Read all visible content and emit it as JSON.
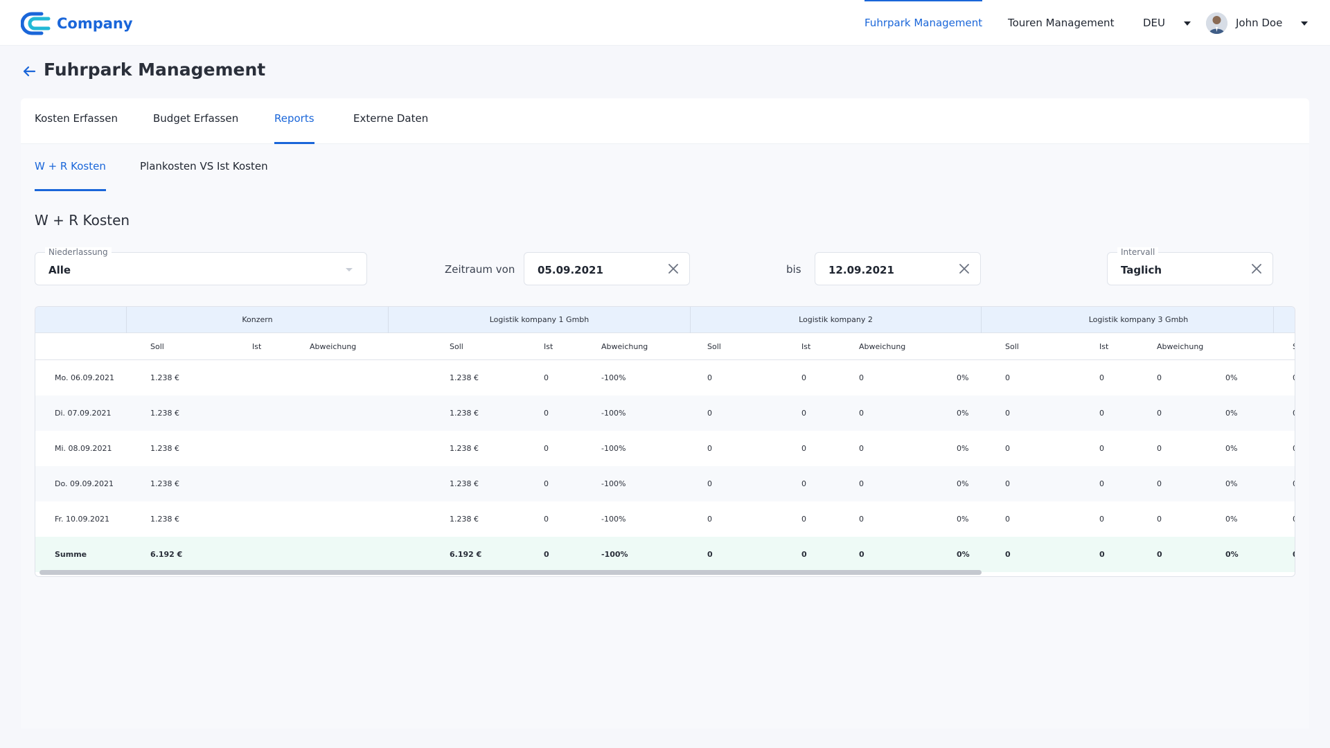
{
  "brand": {
    "name": "Company"
  },
  "nav": {
    "fuhrpark": "Fuhrpark Management",
    "touren": "Touren Management",
    "language": "DEU",
    "user": "John Doe"
  },
  "page": {
    "title": "Fuhrpark Management"
  },
  "tabs": [
    "Kosten Erfassen",
    "Budget Erfassen",
    "Reports",
    "Externe Daten"
  ],
  "subtabs": [
    "W + R Kosten",
    "Plankosten VS Ist Kosten"
  ],
  "section": {
    "title": "W + R Kosten"
  },
  "filters": {
    "niederlassung": {
      "label": "Niederlassung",
      "value": "Alle"
    },
    "zeitraum_von": {
      "label": "Zeitraum von",
      "value": "05.09.2021"
    },
    "bis": {
      "label": "bis",
      "value": "12.09.2021"
    },
    "intervall": {
      "label": "Intervall",
      "value": "Taglich"
    }
  },
  "table": {
    "groups": [
      "Konzern",
      "Logistik kompany 1 Gmbh",
      "Logistik kompany 2",
      "Logistik kompany 3 Gmbh"
    ],
    "columns": [
      "Soll",
      "Ist",
      "Abweichung",
      "Soll",
      "Ist",
      "Abweichung",
      "Soll",
      "Ist",
      "Abweichung",
      "Soll",
      "Ist",
      "Abweichung",
      "S"
    ],
    "rows": [
      {
        "date": "Mo. 06.09.2021",
        "k_soll": "1.238 €",
        "l1_soll": "1.238 €",
        "l1_ist": "0",
        "l1_abw": "-100%",
        "l2_soll": "0",
        "l2_ist": "0",
        "l2_abw": "0",
        "l2_pct": "0%",
        "l3_soll": "0",
        "l3_ist": "0",
        "l3_abw": "0",
        "l3_pct": "0%",
        "cut": "0"
      },
      {
        "date": "Di. 07.09.2021",
        "k_soll": "1.238 €",
        "l1_soll": "1.238 €",
        "l1_ist": "0",
        "l1_abw": "-100%",
        "l2_soll": "0",
        "l2_ist": "0",
        "l2_abw": "0",
        "l2_pct": "0%",
        "l3_soll": "0",
        "l3_ist": "0",
        "l3_abw": "0",
        "l3_pct": "0%",
        "cut": "0"
      },
      {
        "date": "Mi. 08.09.2021",
        "k_soll": "1.238 €",
        "l1_soll": "1.238 €",
        "l1_ist": "0",
        "l1_abw": "-100%",
        "l2_soll": "0",
        "l2_ist": "0",
        "l2_abw": "0",
        "l2_pct": "0%",
        "l3_soll": "0",
        "l3_ist": "0",
        "l3_abw": "0",
        "l3_pct": "0%",
        "cut": "0"
      },
      {
        "date": "Do. 09.09.2021",
        "k_soll": "1.238 €",
        "l1_soll": "1.238 €",
        "l1_ist": "0",
        "l1_abw": "-100%",
        "l2_soll": "0",
        "l2_ist": "0",
        "l2_abw": "0",
        "l2_pct": "0%",
        "l3_soll": "0",
        "l3_ist": "0",
        "l3_abw": "0",
        "l3_pct": "0%",
        "cut": "0"
      },
      {
        "date": "Fr. 10.09.2021",
        "k_soll": "1.238 €",
        "l1_soll": "1.238 €",
        "l1_ist": "0",
        "l1_abw": "-100%",
        "l2_soll": "0",
        "l2_ist": "0",
        "l2_abw": "0",
        "l2_pct": "0%",
        "l3_soll": "0",
        "l3_ist": "0",
        "l3_abw": "0",
        "l3_pct": "0%",
        "cut": "0"
      }
    ],
    "summary": {
      "date": "Summe",
      "k_soll": "6.192 €",
      "l1_soll": "6.192 €",
      "l1_ist": "0",
      "l1_abw": "-100%",
      "l2_soll": "0",
      "l2_ist": "0",
      "l2_abw": "0",
      "l2_pct": "0%",
      "l3_soll": "0",
      "l3_ist": "0",
      "l3_abw": "0",
      "l3_pct": "0%",
      "cut": "0"
    }
  },
  "colors": {
    "accent": "#1a66d9",
    "header_bg": "#e8f1fd",
    "summary_bg": "#eefaf6"
  },
  "icons": [
    "company-logo-icon",
    "chevron-down-icon",
    "avatar",
    "arrow-left-icon",
    "close-icon"
  ]
}
